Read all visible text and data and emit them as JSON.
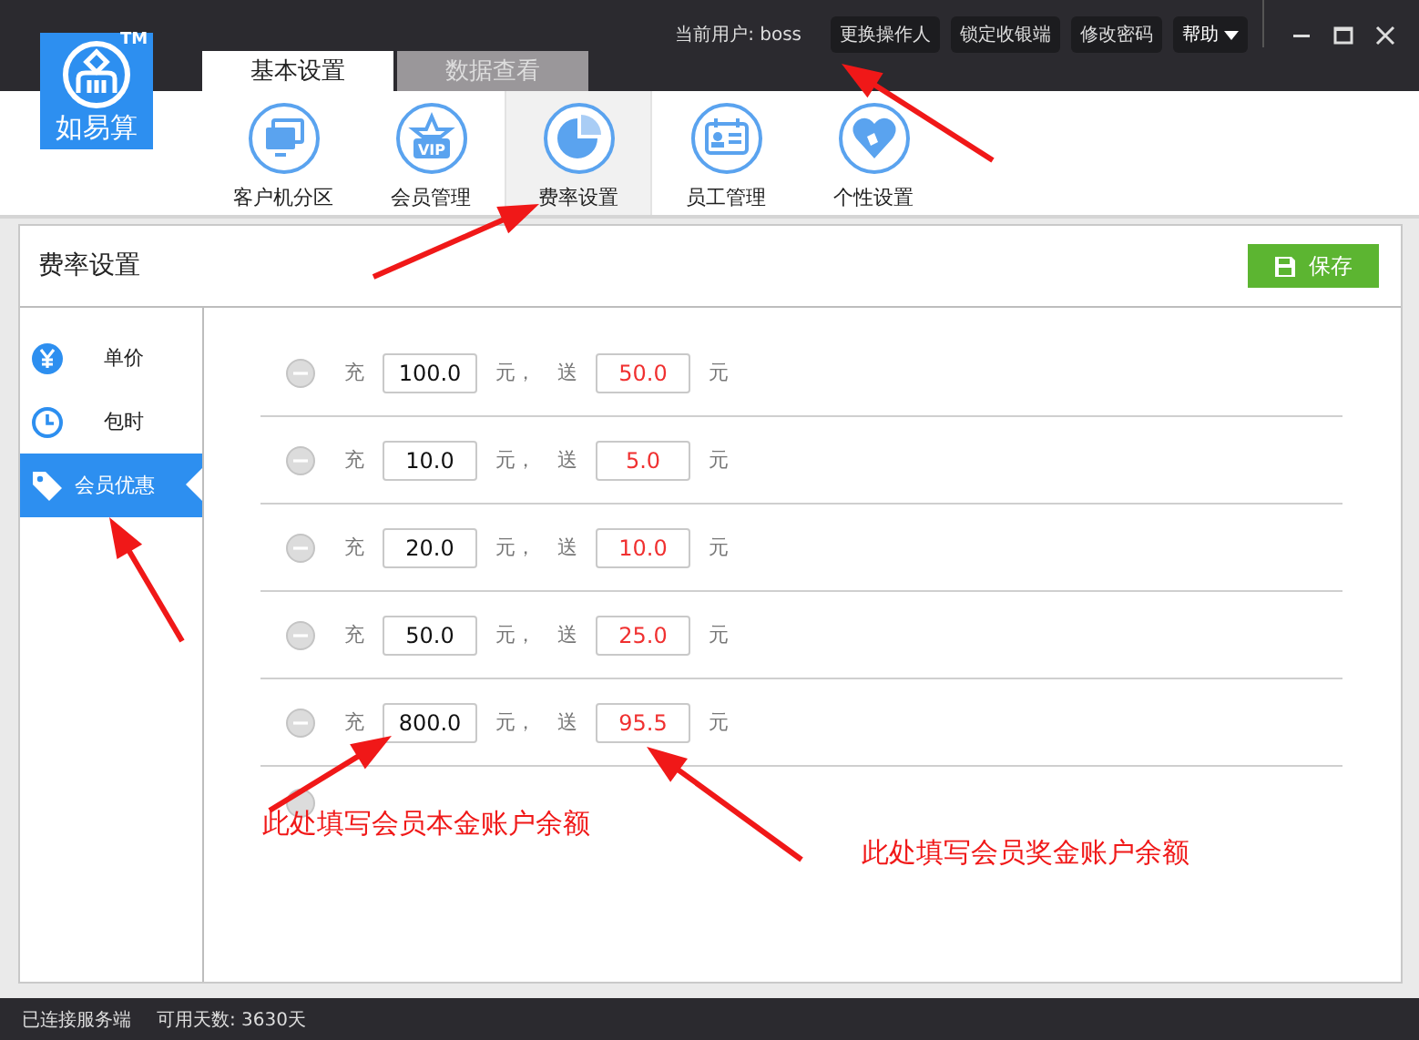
{
  "logo": {
    "text": "如易算",
    "mark": "TM"
  },
  "top_bar": {
    "current_user": "当前用户: boss",
    "buttons": [
      "更换操作人",
      "锁定收银端",
      "修改密码"
    ],
    "help": "帮助"
  },
  "tabs": [
    {
      "label": "基本设置",
      "selected": true
    },
    {
      "label": "数据查看",
      "selected": false
    }
  ],
  "toolbar": [
    {
      "label": "客户机分区",
      "kind": "monitor",
      "selected": false
    },
    {
      "label": "会员管理",
      "kind": "vip",
      "icon_text": "VIP",
      "selected": false
    },
    {
      "label": "费率设置",
      "kind": "pie",
      "selected": true
    },
    {
      "label": "员工管理",
      "kind": "badge",
      "selected": false
    },
    {
      "label": "个性设置",
      "kind": "heart",
      "selected": false
    }
  ],
  "panel": {
    "title": "费率设置",
    "save_button": "保存"
  },
  "sidebar": [
    {
      "label": "单价",
      "kind": "yen",
      "selected": false
    },
    {
      "label": "包时",
      "kind": "clock",
      "selected": false
    },
    {
      "label": "会员优惠",
      "kind": "tag",
      "selected": true
    }
  ],
  "rows": [
    {
      "charge_label": "充",
      "charge": "100.0",
      "unit_label": "元，",
      "bonus_label": "送",
      "bonus": "50.0",
      "end_label": "元"
    },
    {
      "charge_label": "充",
      "charge": "10.0",
      "unit_label": "元，",
      "bonus_label": "送",
      "bonus": "5.0",
      "end_label": "元"
    },
    {
      "charge_label": "充",
      "charge": "20.0",
      "unit_label": "元，",
      "bonus_label": "送",
      "bonus": "10.0",
      "end_label": "元"
    },
    {
      "charge_label": "充",
      "charge": "50.0",
      "unit_label": "元，",
      "bonus_label": "送",
      "bonus": "25.0",
      "end_label": "元"
    },
    {
      "charge_label": "充",
      "charge": "800.0",
      "unit_label": "元，",
      "bonus_label": "送",
      "bonus": "95.5",
      "end_label": "元"
    }
  ],
  "annotations": [
    "此处填写会员本金账户余额",
    "此处填写会员奖金账户余额"
  ],
  "status_bar": {
    "connection": "已连接服务端",
    "days": "可用天数: 3630天"
  }
}
